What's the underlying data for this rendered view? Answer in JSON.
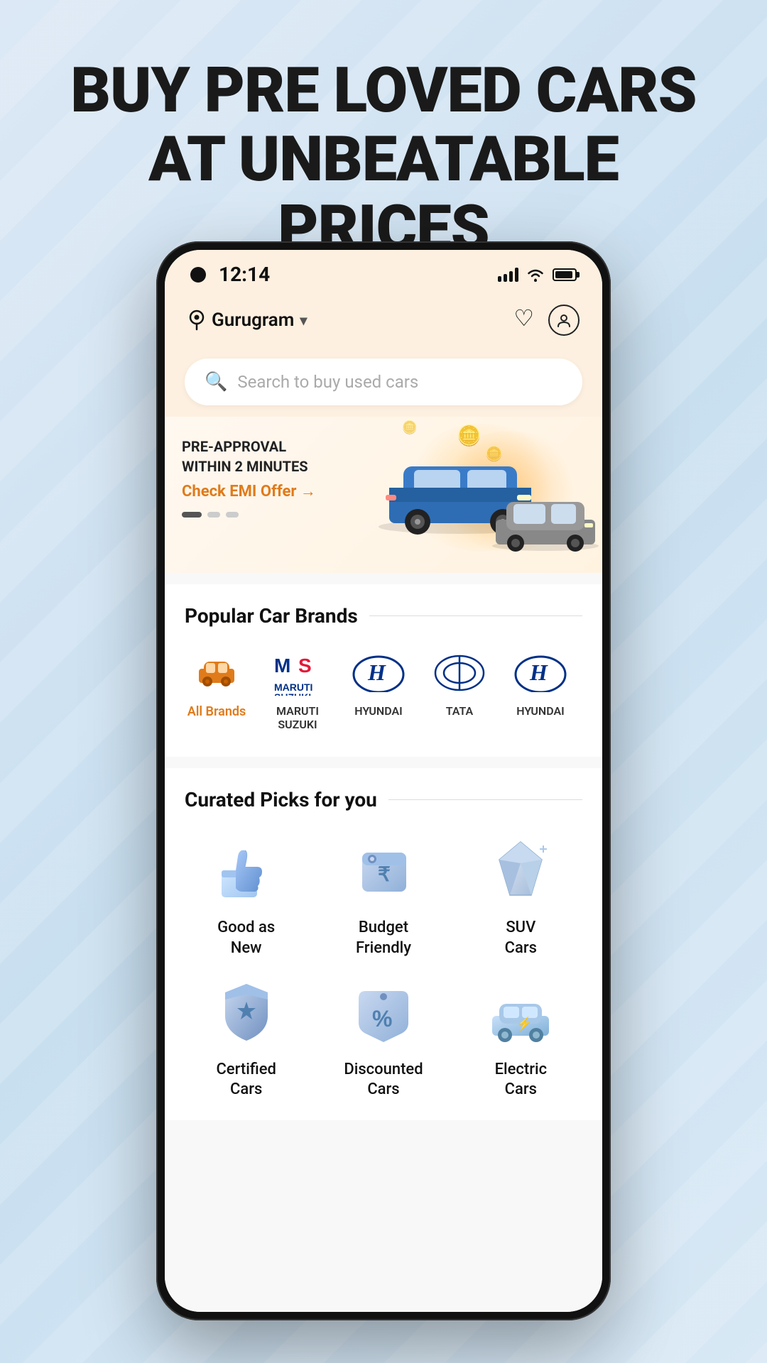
{
  "hero": {
    "title_line1": "BUY PRE LOVED CARS",
    "title_line2": "AT UNBEATABLE PRICES"
  },
  "status_bar": {
    "time": "12:14"
  },
  "nav": {
    "location": "Gurugram",
    "location_icon": "location-pin-icon",
    "chevron_icon": "chevron-down-icon",
    "wishlist_icon": "heart-icon",
    "profile_icon": "profile-icon"
  },
  "search": {
    "placeholder": "Search to buy used cars"
  },
  "banner": {
    "label": "PRE-APPROVAL\nWITHIN 2 MINUTES",
    "cta": "Check EMI Offer →"
  },
  "popular_brands": {
    "title": "Popular Car Brands",
    "items": [
      {
        "id": "all",
        "name": "All Brands",
        "type": "all-brands"
      },
      {
        "id": "maruti",
        "name": "MARUTI\nSUZUKI",
        "type": "maruti"
      },
      {
        "id": "hyundai1",
        "name": "HYUNDAI",
        "type": "hyundai"
      },
      {
        "id": "tata",
        "name": "TATA",
        "type": "tata"
      },
      {
        "id": "hyundai2",
        "name": "HYUNDAI",
        "type": "hyundai"
      }
    ]
  },
  "curated_picks": {
    "title": "Curated Picks for you",
    "items": [
      {
        "id": "good-as-new",
        "label": "Good as\nNew",
        "icon": "thumbs-up-3d-icon"
      },
      {
        "id": "budget-friendly",
        "label": "Budget\nFriendly",
        "icon": "wallet-3d-icon"
      },
      {
        "id": "suv-cars",
        "label": "SUV\nCars",
        "icon": "diamond-3d-icon"
      },
      {
        "id": "certified",
        "label": "Certified\nCars",
        "icon": "shield-star-3d-icon"
      },
      {
        "id": "discount",
        "label": "Discounted\nCars",
        "icon": "tag-percent-3d-icon"
      },
      {
        "id": "electric",
        "label": "Electric\nCars",
        "icon": "car-ev-3d-icon"
      }
    ]
  }
}
